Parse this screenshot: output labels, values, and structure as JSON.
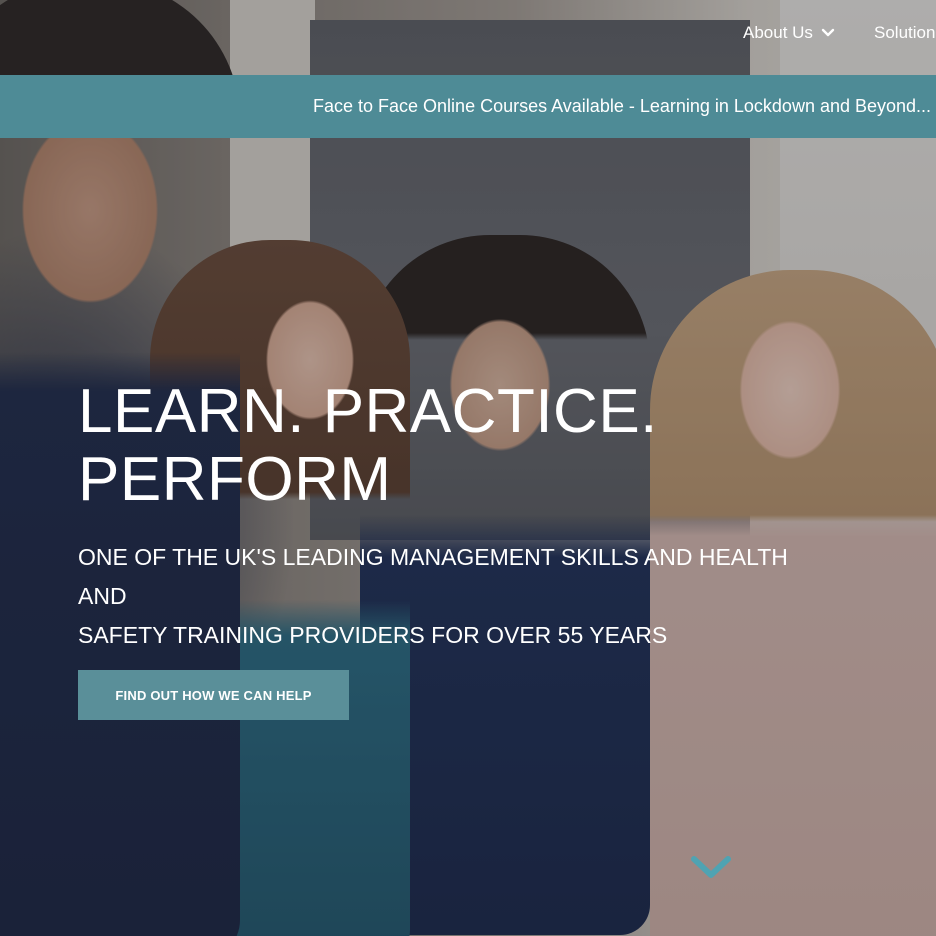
{
  "nav": {
    "items": [
      {
        "label": "About Us",
        "has_dropdown": true
      },
      {
        "label": "Solution",
        "has_dropdown": false
      }
    ]
  },
  "banner": {
    "text": "Face to Face Online Courses Available - Learning in Lockdown and Beyond..."
  },
  "hero": {
    "headline_line1": "LEARN. PRACTICE.",
    "headline_line2": "PERFORM",
    "subheading_line1": "ONE OF THE UK'S LEADING MANAGEMENT SKILLS AND HEALTH AND",
    "subheading_line2": "SAFETY TRAINING PROVIDERS FOR OVER 55 YEARS",
    "cta_label": "FIND OUT HOW WE CAN HELP"
  },
  "icons": {
    "dropdown": "chevron-down-icon",
    "scroll": "chevron-down-icon"
  },
  "colors": {
    "accent": "#4e8b96",
    "button": "#5a8f99",
    "scroll_chevron": "#4fa3b2",
    "text": "#ffffff"
  }
}
